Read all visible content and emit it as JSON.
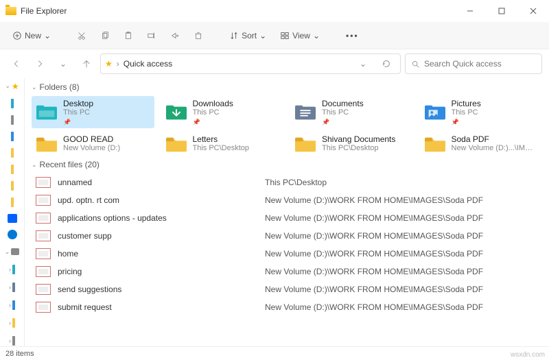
{
  "window": {
    "title": "File Explorer"
  },
  "toolbar": {
    "new": "New",
    "sort": "Sort",
    "view": "View"
  },
  "address": {
    "location": "Quick access"
  },
  "search": {
    "placeholder": "Search Quick access"
  },
  "sections": {
    "folders_label": "Folders (8)",
    "recent_label": "Recent files (20)"
  },
  "folders": [
    {
      "name": "Desktop",
      "sub": "This PC",
      "selected": true,
      "icon": "teal",
      "pinned": true
    },
    {
      "name": "Downloads",
      "sub": "This PC",
      "selected": false,
      "icon": "green",
      "pinned": true
    },
    {
      "name": "Documents",
      "sub": "This PC",
      "selected": false,
      "icon": "slate",
      "pinned": true
    },
    {
      "name": "Pictures",
      "sub": "This PC",
      "selected": false,
      "icon": "blue",
      "pinned": true
    },
    {
      "name": "GOOD READ",
      "sub": "New Volume (D:)",
      "selected": false,
      "icon": "yellow",
      "pinned": false
    },
    {
      "name": "Letters",
      "sub": "This PC\\Desktop",
      "selected": false,
      "icon": "yellow",
      "pinned": false
    },
    {
      "name": "Shivang Documents",
      "sub": "This PC\\Desktop",
      "selected": false,
      "icon": "yellow",
      "pinned": false
    },
    {
      "name": "Soda PDF",
      "sub": "New Volume (D:)...\\IMAGES",
      "selected": false,
      "icon": "yellow",
      "pinned": false
    }
  ],
  "recent": [
    {
      "name": "unnamed",
      "path": "This PC\\Desktop"
    },
    {
      "name": "upd. optn. rt com",
      "path": "New Volume (D:)\\WORK FROM HOME\\IMAGES\\Soda PDF"
    },
    {
      "name": "applications options - updates",
      "path": "New Volume (D:)\\WORK FROM HOME\\IMAGES\\Soda PDF"
    },
    {
      "name": "customer supp",
      "path": "New Volume (D:)\\WORK FROM HOME\\IMAGES\\Soda PDF"
    },
    {
      "name": "home",
      "path": "New Volume (D:)\\WORK FROM HOME\\IMAGES\\Soda PDF"
    },
    {
      "name": "pricing",
      "path": "New Volume (D:)\\WORK FROM HOME\\IMAGES\\Soda PDF"
    },
    {
      "name": "send suggestions",
      "path": "New Volume (D:)\\WORK FROM HOME\\IMAGES\\Soda PDF"
    },
    {
      "name": "submit request",
      "path": "New Volume (D:)\\WORK FROM HOME\\IMAGES\\Soda PDF"
    }
  ],
  "status": {
    "items": "28 items"
  },
  "footer": {
    "site": "wsxdn.com"
  },
  "colors": {
    "teal": "#1fb6c1",
    "green": "#1fa873",
    "slate": "#6b7e99",
    "blue": "#2f8ae0",
    "yellow": "#f6c445"
  }
}
